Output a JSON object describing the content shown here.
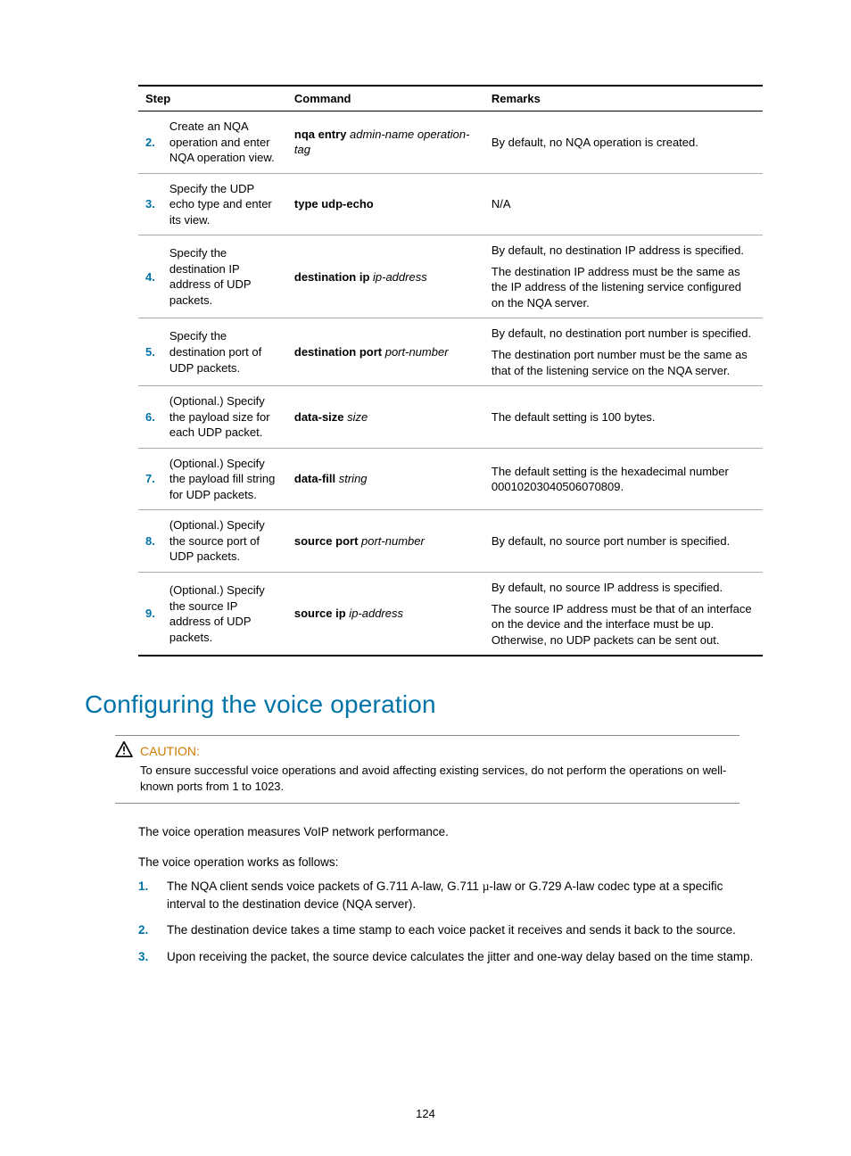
{
  "table": {
    "headers": {
      "step": "Step",
      "command": "Command",
      "remarks": "Remarks"
    },
    "rows": [
      {
        "num": "2.",
        "desc": "Create an NQA operation and enter NQA operation view.",
        "cmd_b": "nqa entry",
        "cmd_i": " admin-name operation-tag",
        "remarks": "By default, no NQA operation is created."
      },
      {
        "num": "3.",
        "desc": "Specify the UDP echo type and enter its view.",
        "cmd_b": "type udp-echo",
        "cmd_i": "",
        "remarks": "N/A"
      },
      {
        "num": "4.",
        "desc": "Specify the destination IP address of UDP packets.",
        "cmd_b": "destination ip",
        "cmd_i": " ip-address",
        "remarks_a": "By default, no destination IP address is specified.",
        "remarks_b": "The destination IP address must be the same as the IP address of the listening service configured on the NQA server."
      },
      {
        "num": "5.",
        "desc": "Specify the destination port of UDP packets.",
        "cmd_b": "destination port",
        "cmd_i": " port-number",
        "remarks_a": "By default, no destination port number is specified.",
        "remarks_b": "The destination port number must be the same as that of the listening service on the NQA server."
      },
      {
        "num": "6.",
        "desc": "(Optional.) Specify the payload size for each UDP packet.",
        "cmd_b": "data-size",
        "cmd_i": " size",
        "remarks": "The default setting is 100 bytes."
      },
      {
        "num": "7.",
        "desc": "(Optional.) Specify the payload fill string for UDP packets.",
        "cmd_b": "data-fill",
        "cmd_i": " string",
        "remarks": "The default setting is the hexadecimal number 00010203040506070809."
      },
      {
        "num": "8.",
        "desc": "(Optional.) Specify the source port of UDP packets.",
        "cmd_b": "source port",
        "cmd_i": " port-number",
        "remarks": "By default, no source port number is specified."
      },
      {
        "num": "9.",
        "desc": "(Optional.) Specify the source IP address of UDP packets.",
        "cmd_b": "source ip",
        "cmd_i": " ip-address",
        "remarks_a": "By default, no source IP address is specified.",
        "remarks_b": "The source IP address must be that of an interface on the device and the interface must be up. Otherwise, no UDP packets can be sent out."
      }
    ]
  },
  "section_heading": "Configuring the voice operation",
  "caution": {
    "label": "CAUTION:",
    "text": "To ensure successful voice operations and avoid affecting existing services, do not perform the operations on well-known ports from 1 to 1023."
  },
  "para1": "The voice operation measures VoIP network performance.",
  "para2": "The voice operation works as follows:",
  "list": [
    {
      "n": "1.",
      "t_pre": "The NQA client sends voice packets of G.711 A-law, G.711 ",
      "t_mu": "µ",
      "t_post": "-law or G.729 A-law codec type at a specific interval to the destination device (NQA server)."
    },
    {
      "n": "2.",
      "t": "The destination device takes a time stamp to each voice packet it receives and sends it back to the source."
    },
    {
      "n": "3.",
      "t": "Upon receiving the packet, the source device calculates the jitter and one-way delay based on the time stamp."
    }
  ],
  "page_number": "124"
}
